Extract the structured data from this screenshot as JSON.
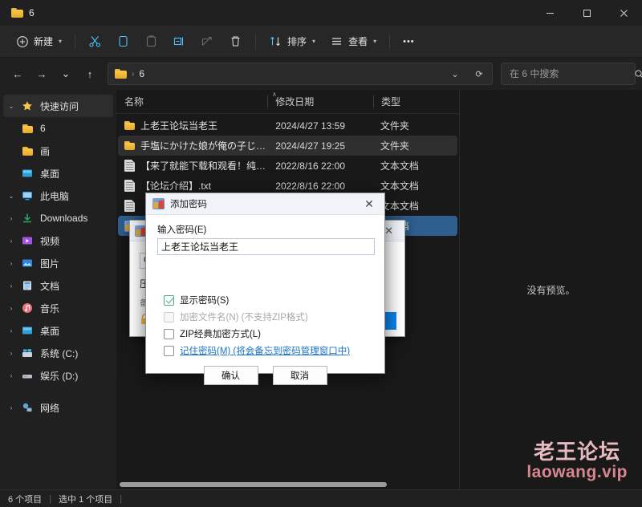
{
  "window": {
    "tab_title": "6",
    "minimize_label": "–",
    "maximize_label": "☐",
    "close_label": "✕"
  },
  "toolbar": {
    "new_label": "新建",
    "cut_label": "剪切",
    "copy_label": "复制",
    "paste_label": "粘贴",
    "rename_label": "重命名",
    "share_label": "共享",
    "delete_label": "删除",
    "sort_label": "排序",
    "view_label": "查看",
    "more_label": "•••"
  },
  "addressbar": {
    "back": "←",
    "forward": "→",
    "recent": "⌄",
    "up": "↑",
    "crumb_root": "",
    "crumb_sep": "›",
    "crumb_current": "6",
    "dropdown": "⌄",
    "refresh": "⟳"
  },
  "search": {
    "placeholder": "在 6 中搜索",
    "value": "",
    "icon": "search-icon"
  },
  "sidebar": {
    "items": [
      {
        "label": "快速访问",
        "twisty": "⌄",
        "icon": "star-icon",
        "indent": 0,
        "selected": true
      },
      {
        "label": "6",
        "twisty": "",
        "icon": "folder-icon",
        "indent": 1,
        "selected": false
      },
      {
        "label": "画",
        "twisty": "",
        "icon": "folder-icon",
        "indent": 1,
        "selected": false
      },
      {
        "label": "桌面",
        "twisty": "",
        "icon": "desktop-icon",
        "indent": 1,
        "selected": false
      },
      {
        "label": "此电脑",
        "twisty": "⌄",
        "icon": "pc-icon",
        "indent": 0,
        "selected": false
      },
      {
        "label": "Downloads",
        "twisty": "›",
        "icon": "download-icon",
        "indent": 1,
        "selected": false
      },
      {
        "label": "视频",
        "twisty": "›",
        "icon": "video-icon",
        "indent": 1,
        "selected": false
      },
      {
        "label": "图片",
        "twisty": "›",
        "icon": "pictures-icon",
        "indent": 1,
        "selected": false
      },
      {
        "label": "文档",
        "twisty": "›",
        "icon": "documents-icon",
        "indent": 1,
        "selected": false
      },
      {
        "label": "音乐",
        "twisty": "›",
        "icon": "music-icon",
        "indent": 1,
        "selected": false
      },
      {
        "label": "桌面",
        "twisty": "›",
        "icon": "desktop-icon",
        "indent": 1,
        "selected": false
      },
      {
        "label": "系统 (C:)",
        "twisty": "›",
        "icon": "drive-windows-icon",
        "indent": 1,
        "selected": false
      },
      {
        "label": "娱乐 (D:)",
        "twisty": "›",
        "icon": "drive-icon",
        "indent": 1,
        "selected": false
      },
      {
        "label": "网络",
        "twisty": "›",
        "icon": "network-icon",
        "indent": 0,
        "selected": false
      }
    ]
  },
  "filelist": {
    "columns": {
      "name": "名称",
      "date": "修改日期",
      "type": "类型"
    },
    "sort_indicator": "∧",
    "rows": [
      {
        "name": "上老王论坛当老王",
        "date": "2024/4/27 13:59",
        "type": "文件夹",
        "icon": "folder-icon",
        "state": "normal"
      },
      {
        "name": "手塩にかけた娘が俺の子じゃないと判明...",
        "date": "2024/4/27 19:25",
        "type": "文件夹",
        "icon": "folder-icon",
        "state": "hover"
      },
      {
        "name": "【来了就能下载和观看！纯免费！】.txt",
        "date": "2022/8/16 22:00",
        "type": "文本文档",
        "icon": "text-file-icon",
        "state": "normal"
      },
      {
        "name": "【论坛介绍】.txt",
        "date": "2022/8/16 22:00",
        "type": "文本文档",
        "icon": "text-file-icon",
        "state": "normal"
      },
      {
        "name": "【",
        "date": "",
        "type": "文本文档",
        "icon": "text-file-icon",
        "state": "normal"
      },
      {
        "name": "",
        "date": "",
        "type": "本文档",
        "icon": "archive-icon",
        "state": "selected"
      }
    ]
  },
  "preview": {
    "empty_text": "没有预览。"
  },
  "watermark": {
    "line1": "老王论坛",
    "line2": "laowang.vip"
  },
  "statusbar": {
    "count": "6 个项目",
    "sep1": "|",
    "selected": "选中 1 个项目",
    "sep2": "|"
  },
  "back_dialog": {
    "title": "",
    "close": "✕",
    "field_value": "6",
    "line1": "压",
    "line2": "备",
    "icon": "archive-icon"
  },
  "dialog": {
    "title": "添加密码",
    "icon": "archive-icon",
    "close": "✕",
    "password_label": "输入密码(E)",
    "password_value": "上老王论坛当老王",
    "password_placeholder": "",
    "checkboxes": [
      {
        "label": "显示密码(S)",
        "checked": true,
        "disabled": false,
        "link": false
      },
      {
        "label": "加密文件名(N) (不支持ZIP格式)",
        "checked": false,
        "disabled": true,
        "link": false
      },
      {
        "label": "ZIP经典加密方式(L)",
        "checked": false,
        "disabled": false,
        "link": false
      },
      {
        "label": "记住密码(M) (将会备忘到密码管理窗口中)",
        "checked": false,
        "disabled": false,
        "link": true
      }
    ],
    "ok_label": "确认",
    "cancel_label": "取消"
  },
  "colors": {
    "window_bg": "#202020",
    "list_bg": "#191919",
    "accent": "#4cc2ff",
    "selection": "#2f5f8f",
    "watermark_pink": "#e8b9bf",
    "watermark_rose": "#d8868f"
  }
}
